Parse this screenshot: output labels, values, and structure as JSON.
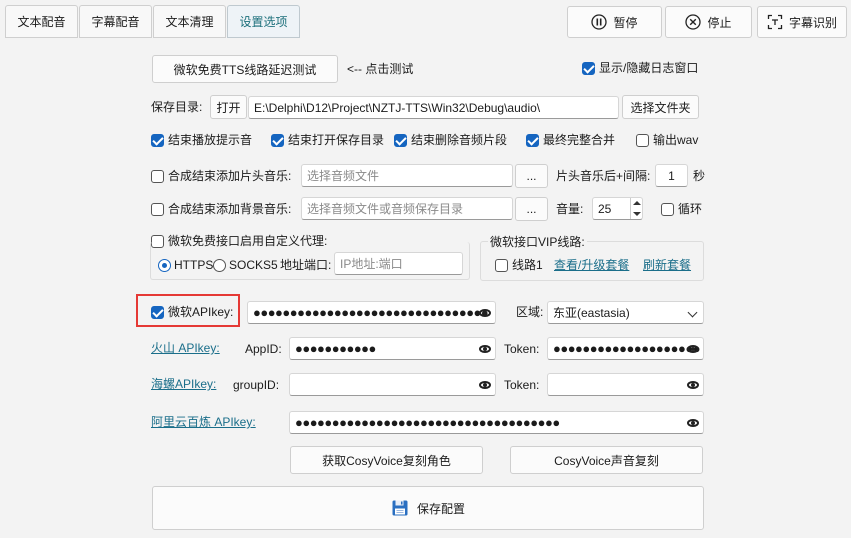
{
  "tabs": [
    {
      "label": "文本配音"
    },
    {
      "label": "字幕配音"
    },
    {
      "label": "文本清理"
    },
    {
      "label": "设置选项"
    }
  ],
  "toolbar": {
    "pause_label": "暂停",
    "stop_label": "停止",
    "subtitle_recog_label": "字幕识别"
  },
  "latency_test": {
    "button_label": "微软免费TTS线路延迟测试",
    "hint": "<-- 点击测试"
  },
  "log_toggle": {
    "label": "显示/隐藏日志窗口",
    "checked": true
  },
  "save_dir": {
    "label": "保存目录:",
    "open_label": "打开",
    "path": "E:\\Delphi\\D12\\Project\\NZTJ-TTS\\Win32\\Debug\\audio\\",
    "choose_label": "选择文件夹"
  },
  "options": [
    {
      "label": "结束播放提示音",
      "checked": true
    },
    {
      "label": "结束打开保存目录",
      "checked": true
    },
    {
      "label": "结束删除音频片段",
      "checked": true
    },
    {
      "label": "最终完整合并",
      "checked": true
    },
    {
      "label": "输出wav",
      "checked": false
    }
  ],
  "intro_music": {
    "label": "合成结束添加片头音乐:",
    "placeholder": "选择音频文件",
    "browse_label": "...",
    "interval_label": "片头音乐后+间隔:",
    "interval_value": "1",
    "interval_unit": "秒",
    "checked": false
  },
  "bg_music": {
    "label": "合成结束添加背景音乐:",
    "placeholder": "选择音频文件或音频保存目录",
    "browse_label": "...",
    "volume_label": "音量:",
    "volume_value": "25",
    "loop_label": "循环",
    "checked": false,
    "loop_checked": false
  },
  "proxy": {
    "label": "微软免费接口启用自定义代理:",
    "checked": false,
    "https_label": "HTTPS",
    "socks5_label": "SOCKS5",
    "address_label": "地址端口:",
    "address_placeholder": "IP地址:端口",
    "selected": "HTTPS"
  },
  "vip": {
    "group_label": "微软接口VIP线路:",
    "line1_label": "线路1",
    "line1_checked": false,
    "upgrade_link": "查看/升级套餐",
    "refresh_link": "刷新套餐"
  },
  "ms_key": {
    "label": "微软APIkey:",
    "checked": true,
    "masked": "●●●●●●●●●●●●●●●●●●●●●●●●●●●●●●●●",
    "region_label": "区域:",
    "region_value": "东亚(eastasia)"
  },
  "volc": {
    "link": "火山 APIkey:",
    "appid_label": "AppID:",
    "appid_masked": "●●●●●●●●●●●",
    "token_label": "Token:",
    "token_masked": "●●●●●●●●●●●●●●●●●●●●"
  },
  "minimax": {
    "link": "海螺APIkey:",
    "groupid_label": "groupID:",
    "groupid_masked": "",
    "token_label": "Token:",
    "token_masked": ""
  },
  "aliyun": {
    "link": "阿里云百炼 APIkey:",
    "masked": "●●●●●●●●●●●●●●●●●●●●●●●●●●●●●●●●●●●●"
  },
  "cosy": {
    "get_roles_label": "获取CosyVoice复刻角色",
    "clone_label": "CosyVoice声音复刻"
  },
  "save_config_label": "保存配置",
  "icons": {
    "pause": "pause-circle-icon",
    "stop": "close-circle-icon",
    "subtitle": "scan-text-icon",
    "save": "floppy-disk-icon",
    "eye": "eye-icon"
  },
  "colors": {
    "accent": "#1565c0",
    "link": "#1a6e8a",
    "highlight_border": "#e53935",
    "active_tab_text": "#1a6e7a"
  }
}
